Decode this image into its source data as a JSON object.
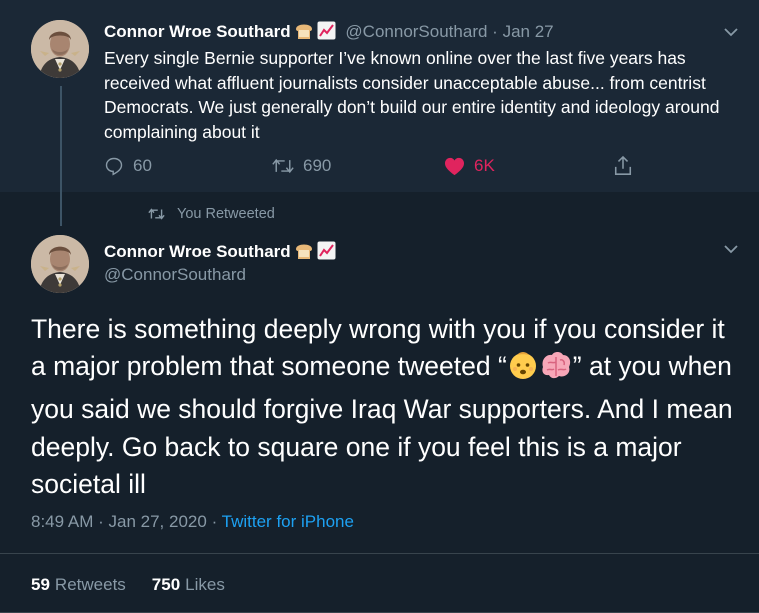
{
  "tweet1": {
    "author_name": "Connor Wroe Southard",
    "author_badges": [
      "bread-emoji",
      "chart-increasing-emoji"
    ],
    "handle": "@ConnorSouthard",
    "separator": "·",
    "date": "Jan 27",
    "text": "Every single Bernie supporter I’ve known online over the last five years has received what affluent journalists consider unacceptable abuse... from centrist Democrats. We just generally don’t build our entire identity and ideology around complaining about it",
    "actions": {
      "reply_count": "60",
      "retweet_count": "690",
      "like_count": "6K",
      "liked": true
    }
  },
  "retweet_note": "You Retweeted",
  "tweet2": {
    "author_name": "Connor Wroe Southard",
    "author_badges": [
      "bread-emoji",
      "chart-increasing-emoji"
    ],
    "handle": "@ConnorSouthard",
    "text_before_emoji": "There is something deeply wrong with you if you consider it a major problem that someone tweeted “",
    "text_emojis": [
      "baby-emoji",
      "brain-emoji"
    ],
    "text_after_emoji": "” at you when you said we should forgive Iraq War supporters. And I mean deeply. Go back to square one if you feel this is a major societal ill",
    "time": "8:49 AM",
    "separator": "·",
    "date": "Jan 27, 2020",
    "separator2": "·",
    "source": "Twitter for iPhone",
    "retweets_count": "59",
    "retweets_label": "Retweets",
    "likes_count": "750",
    "likes_label": "Likes"
  },
  "colors": {
    "background": "#15202b",
    "highlight_background": "#1b2836",
    "muted_text": "#8899a6",
    "link": "#1da1f2",
    "like": "#e0245e",
    "divider": "#38444d"
  }
}
